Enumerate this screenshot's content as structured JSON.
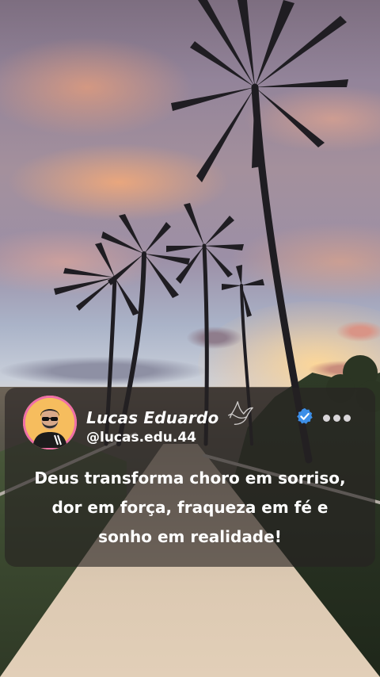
{
  "post": {
    "author_name": "Lucas Eduardo",
    "handle": "@lucas.edu.44",
    "message": "Deus transforma choro em sorriso, dor em força, fraqueza em fé e sonho em realidade!",
    "icons": {
      "avatar": "person-with-sunglasses",
      "dove": "dove-icon",
      "verified": "verified-badge-icon",
      "more": "more-options-icon"
    }
  },
  "colors": {
    "verified": "#3d8fe8",
    "avatar_ring": "#ef6fa8",
    "avatar_bg": "#f5b85c"
  }
}
